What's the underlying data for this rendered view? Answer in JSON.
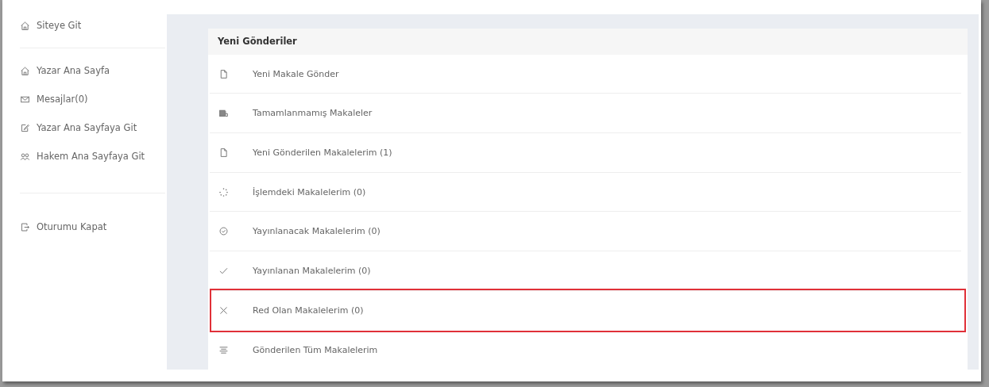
{
  "sidebar": {
    "groups": [
      {
        "items": [
          {
            "label": "Siteye Git",
            "kind": "home"
          }
        ]
      },
      {
        "items": [
          {
            "label": "Yazar Ana Sayfa",
            "kind": "home"
          },
          {
            "label": "Mesajlar(0)",
            "kind": "mail"
          },
          {
            "label": "Yazar Ana Sayfaya Git",
            "kind": "edit"
          },
          {
            "label": "Hakem Ana Sayfaya Git",
            "kind": "users"
          }
        ]
      },
      {
        "items": [
          {
            "label": "Oturumu Kapat",
            "kind": "logout"
          }
        ]
      }
    ]
  },
  "panel": {
    "title": "Yeni Gönderiler",
    "items": [
      {
        "label": "Yeni Makale Gönder",
        "kind": "file",
        "highlighted": false
      },
      {
        "label": "Tamamlanmamış Makaleler",
        "kind": "book",
        "highlighted": false
      },
      {
        "label": "Yeni Gönderilen Makalelerim (1)",
        "kind": "file",
        "highlighted": false
      },
      {
        "label": "İşlemdeki Makalelerim (0)",
        "kind": "spinner",
        "highlighted": false
      },
      {
        "label": "Yayınlanacak Makalelerim (0)",
        "kind": "check-circle",
        "highlighted": false
      },
      {
        "label": "Yayınlanan Makalelerim (0)",
        "kind": "check",
        "highlighted": false
      },
      {
        "label": "Red Olan Makalelerim (0)",
        "kind": "x",
        "highlighted": true
      },
      {
        "label": "Gönderilen Tüm Makalelerim",
        "kind": "list",
        "highlighted": false
      }
    ]
  }
}
